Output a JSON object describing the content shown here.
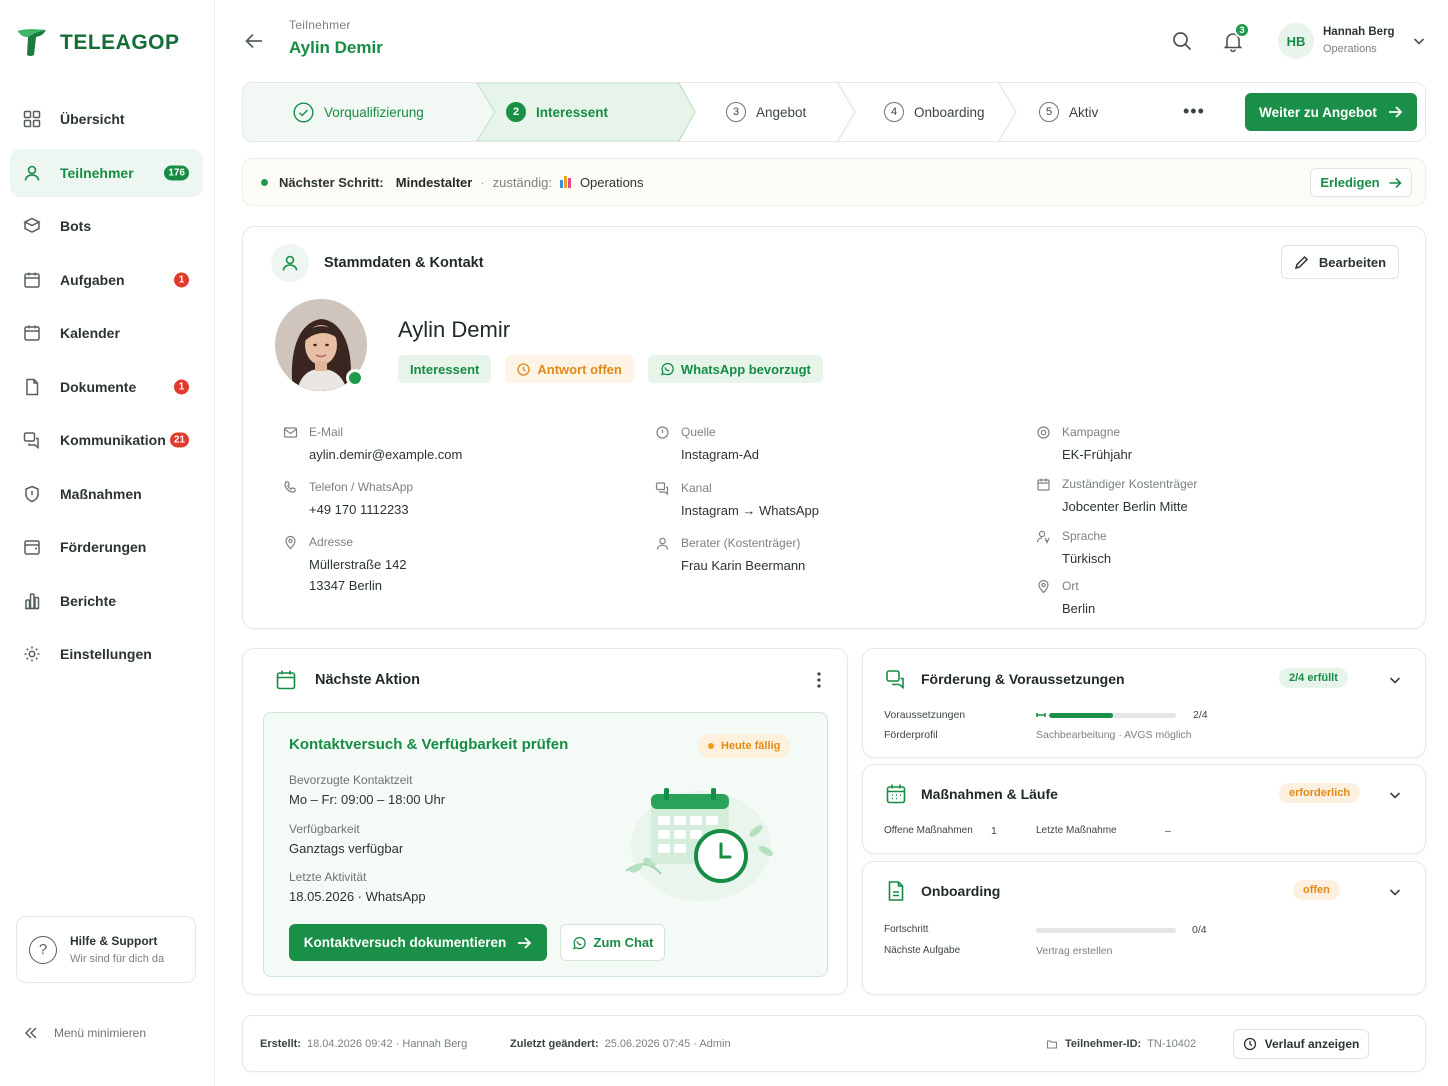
{
  "brand": {
    "name": "TELEAGOP"
  },
  "sidebar": {
    "items": [
      {
        "label": "Übersicht"
      },
      {
        "label": "Teilnehmer",
        "badge": "176"
      },
      {
        "label": "Bots"
      },
      {
        "label": "Aufgaben",
        "badge": "1"
      },
      {
        "label": "Kalender"
      },
      {
        "label": "Dokumente",
        "badge": "1"
      },
      {
        "label": "Kommunikation",
        "badge": "21"
      },
      {
        "label": "Maßnahmen"
      },
      {
        "label": "Förderungen"
      },
      {
        "label": "Berichte"
      },
      {
        "label": "Einstellungen"
      }
    ],
    "help": {
      "title": "Hilfe & Support",
      "subtitle": "Wir sind für dich da"
    },
    "minimize_label": "Menü minimieren"
  },
  "header": {
    "breadcrumb": "Teilnehmer",
    "title": "Aylin Demir",
    "notifications_count": "3",
    "user": {
      "initials": "HB",
      "name": "Hannah Berg",
      "role": "Operations"
    }
  },
  "stepper": {
    "steps": [
      {
        "num": "",
        "label": "Vorqualifizierung"
      },
      {
        "num": "2",
        "label": "Interessent"
      },
      {
        "num": "3",
        "label": "Angebot"
      },
      {
        "num": "4",
        "label": "Onboarding"
      },
      {
        "num": "5",
        "label": "Aktiv"
      }
    ],
    "more": "•••",
    "next_button": "Weiter zu Angebot"
  },
  "next_step": {
    "label": "Nächster Schritt:",
    "value": "Mindestalter",
    "sep": "·",
    "owner_label": "zuständig:",
    "owner": "Operations",
    "action": "Erledigen"
  },
  "stammdaten": {
    "title": "Stammdaten & Kontakt",
    "edit_button": "Bearbeiten",
    "name": "Aylin Demir",
    "tags": [
      "Interessent",
      "Antwort offen",
      "WhatsApp bevorzugt"
    ],
    "fields": {
      "email": {
        "label": "E-Mail",
        "value": "aylin.demir@example.com"
      },
      "phone": {
        "label": "Telefon / WhatsApp",
        "value": "+49 170 1112233"
      },
      "address": {
        "label": "Adresse",
        "line1": "Müllerstraße 142",
        "line2": "13347 Berlin"
      },
      "source": {
        "label": "Quelle",
        "value": "Instagram-Ad"
      },
      "channel": {
        "label": "Kanal",
        "value": "Instagram → WhatsApp"
      },
      "advisor": {
        "label": "Berater (Kostenträger)",
        "value": "Frau Karin Beermann"
      },
      "campaign": {
        "label": "Kampagne",
        "value": "EK-Frühjahr"
      },
      "payer": {
        "label": "Zuständiger Kostenträger",
        "value": "Jobcenter Berlin Mitte"
      },
      "language": {
        "label": "Sprache",
        "value": "Türkisch"
      },
      "location": {
        "label": "Ort",
        "value": "Berlin"
      }
    }
  },
  "next_action": {
    "title": "Nächste Aktion",
    "task_title": "Kontaktversuch & Verfügbarkeit prüfen",
    "due": "Heute fällig",
    "contact_time_label": "Bevorzugte Kontaktzeit",
    "contact_time": "Mo – Fr: 09:00 – 18:00 Uhr",
    "availability_label": "Verfügbarkeit",
    "availability": "Ganztags verfügbar",
    "last_activity_label": "Letzte Aktivität",
    "last_activity": "18.05.2026  ·  WhatsApp",
    "primary_button": "Kontaktversuch dokumentieren",
    "secondary_button": "Zum Chat"
  },
  "panels": {
    "foerderung": {
      "title": "Förderung & Voraussetzungen",
      "badge": "2/4 erfüllt",
      "row1_label": "Voraussetzungen",
      "row1_value": "2/4",
      "progress": 0.5,
      "row2_label": "Förderprofil",
      "row2_value": "Sachbearbeitung · AVGS möglich"
    },
    "massnahmen": {
      "title": "Maßnahmen & Läufe",
      "badge": "erforderlich",
      "open_label": "Offene Maßnahmen",
      "open_value": "1",
      "last_label": "Letzte Maßnahme",
      "last_value": "–"
    },
    "onboarding": {
      "title": "Onboarding",
      "badge": "offen",
      "progress_label": "Fortschritt",
      "progress_value": "0/4",
      "progress": 0,
      "next_task_label": "Nächste Aufgabe",
      "next_task": "Vertrag erstellen"
    }
  },
  "footer": {
    "created_label": "Erstellt:",
    "created": "18.04.2026 09:42  ·  Hannah Berg",
    "modified_label": "Zuletzt geändert:",
    "modified": "25.06.2026 07:45  ·  Admin",
    "id_label": "Teilnehmer-ID:",
    "id": "TN-10402",
    "history_button": "Verlauf anzeigen"
  },
  "colors": {
    "accent": "#178c45",
    "warning": "#e08a17",
    "danger": "#e23b2e"
  }
}
